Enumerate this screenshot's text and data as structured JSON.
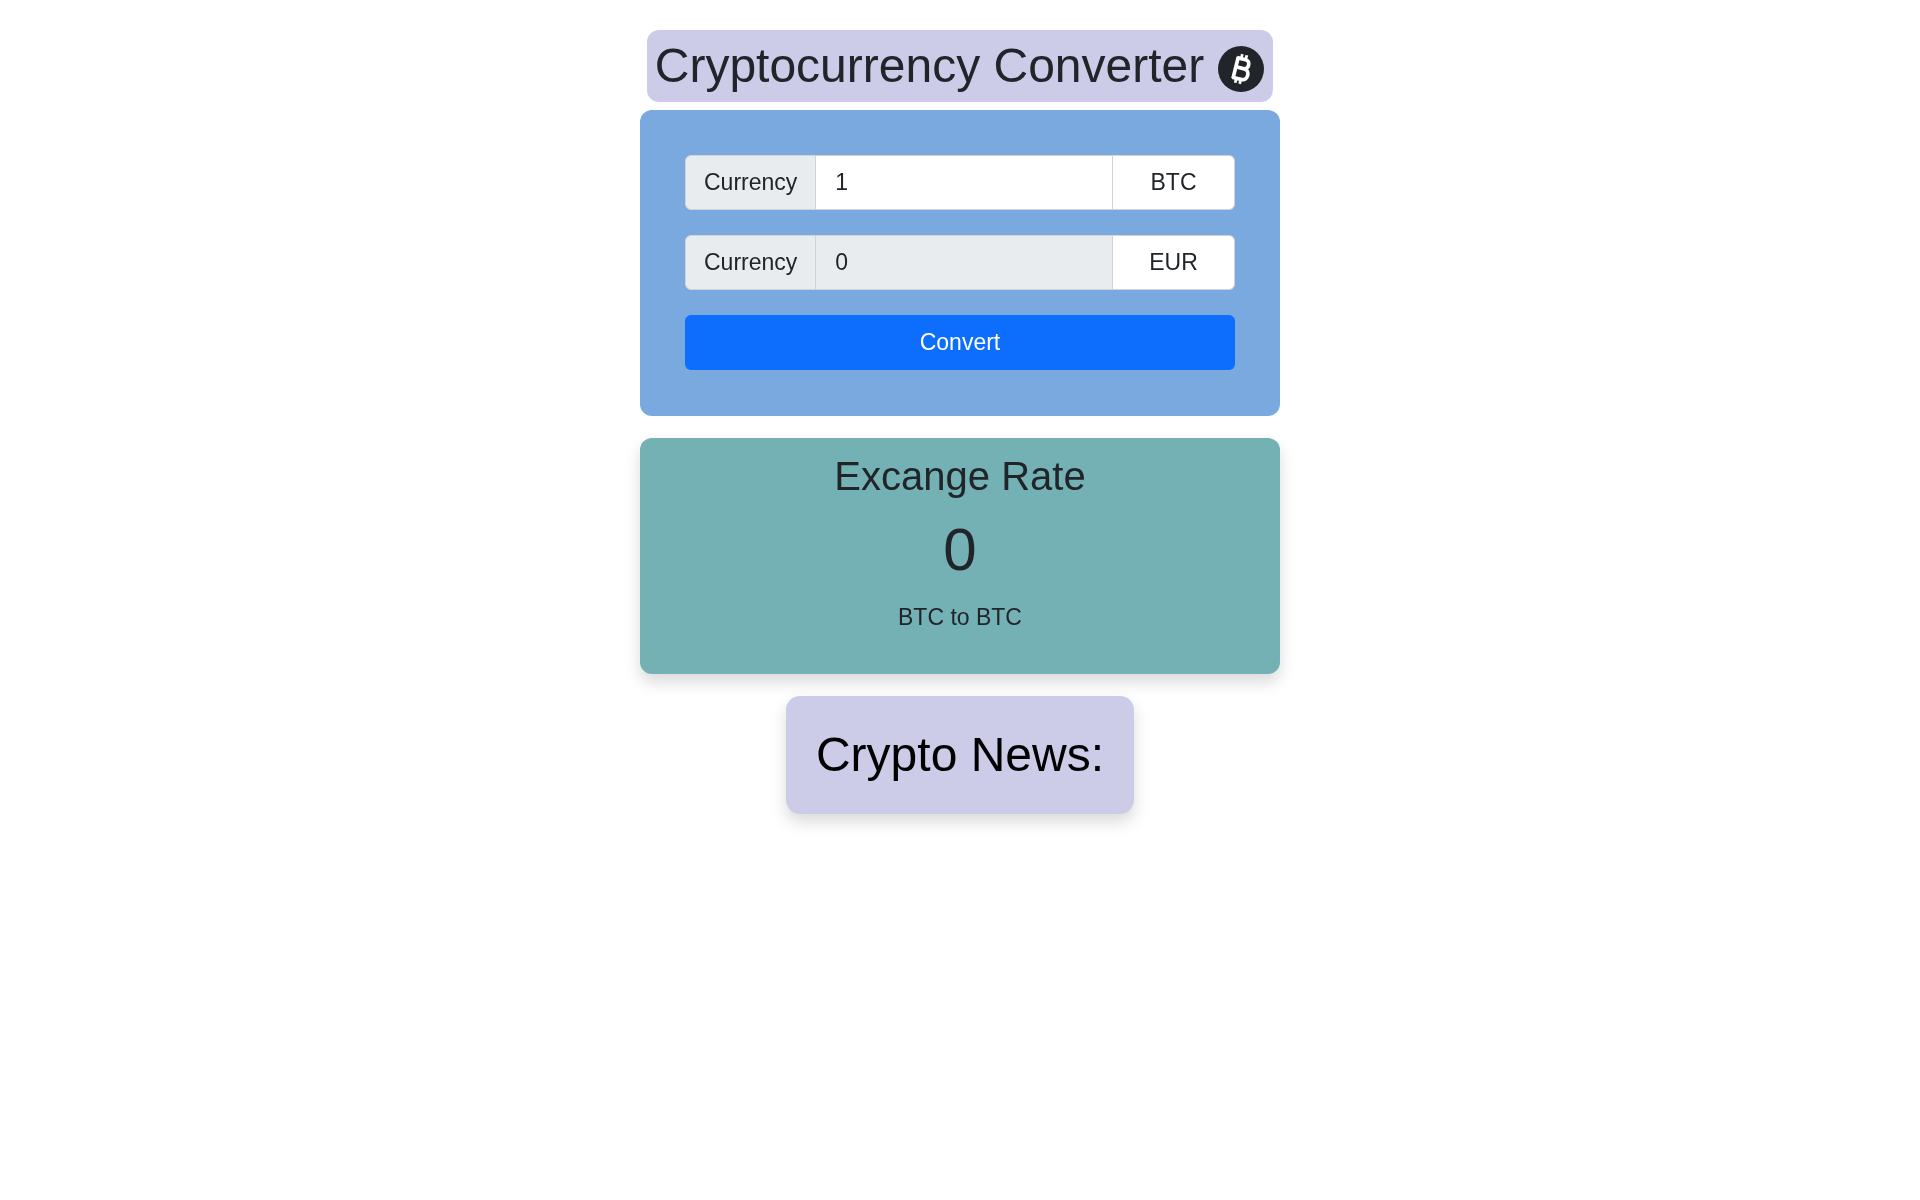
{
  "header": {
    "title": "Cryptocurrency Converter"
  },
  "converter": {
    "rows": [
      {
        "label": "Currency",
        "value": "1",
        "currency": "BTC",
        "disabled": false
      },
      {
        "label": "Currency",
        "value": "0",
        "currency": "EUR",
        "disabled": true
      }
    ],
    "button": "Convert"
  },
  "exchange_rate": {
    "heading": "Excange Rate",
    "value": "0",
    "pair": "BTC to BTC"
  },
  "news": {
    "heading": "Crypto News:"
  }
}
